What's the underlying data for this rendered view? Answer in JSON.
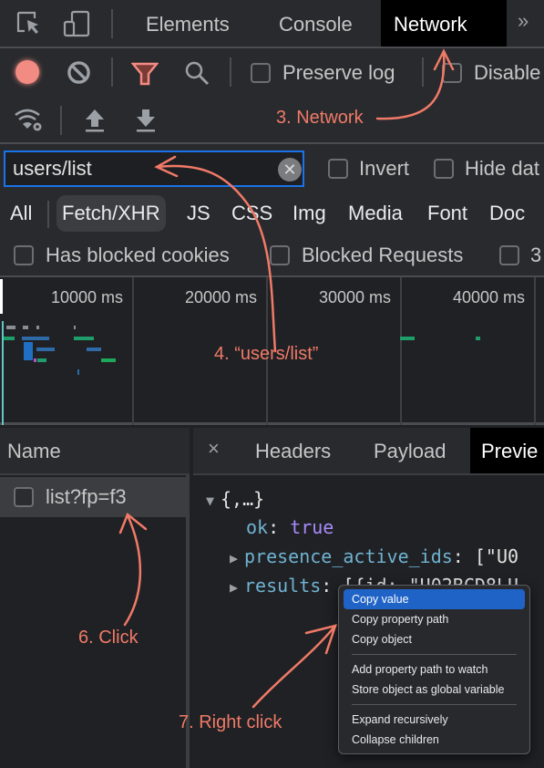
{
  "tabs": {
    "items": [
      {
        "label": "Elements",
        "active": false
      },
      {
        "label": "Console",
        "active": false
      },
      {
        "label": "Network",
        "active": true
      }
    ],
    "more_icon": "double-chevron-right"
  },
  "toolbar": {
    "icons": [
      "inspect-element-icon",
      "device-toolbar-icon",
      "record-icon",
      "clear-icon",
      "filter-icon",
      "search-icon",
      "network-conditions-icon",
      "import-har-icon",
      "export-har-icon"
    ],
    "preserve_log": {
      "label": "Preserve log",
      "checked": false
    },
    "disable_cache": {
      "label": "Disable",
      "checked": false
    },
    "record_color": "#f28b82",
    "filter_color": "#f28b82"
  },
  "filter": {
    "value": "users/list",
    "invert": {
      "label": "Invert",
      "checked": false
    },
    "hide_data_urls": {
      "label": "Hide dat",
      "checked": false
    }
  },
  "types": [
    {
      "label": "All",
      "active": false
    },
    {
      "label": "Fetch/XHR",
      "active": true
    },
    {
      "label": "JS",
      "active": false
    },
    {
      "label": "CSS",
      "active": false
    },
    {
      "label": "Img",
      "active": false
    },
    {
      "label": "Media",
      "active": false
    },
    {
      "label": "Font",
      "active": false
    },
    {
      "label": "Doc",
      "active": false
    }
  ],
  "blocked": {
    "has_blocked_cookies": {
      "label": "Has blocked cookies",
      "checked": false
    },
    "blocked_requests": {
      "label": "Blocked Requests",
      "checked": false
    },
    "third_party": {
      "label": "3",
      "checked": false
    }
  },
  "timeline": {
    "ticks": [
      "10000 ms",
      "20000 ms",
      "30000 ms",
      "40000 ms"
    ]
  },
  "requests": {
    "header": "Name",
    "rows": [
      {
        "name": "list?fp=f3",
        "selected": true
      }
    ]
  },
  "detail": {
    "tabs": [
      {
        "label": "Headers",
        "active": false
      },
      {
        "label": "Payload",
        "active": false
      },
      {
        "label": "Previe",
        "active": true
      }
    ],
    "close_label": "×",
    "preview": {
      "root": "{,…}",
      "ok_key": "ok",
      "ok_value": "true",
      "presence_key": "presence_active_ids",
      "presence_value": "[\"U0",
      "results_key": "results",
      "results_value": "[{id: \"U02BCD8LU"
    }
  },
  "context_menu": {
    "groups": [
      [
        "Copy value",
        "Copy property path",
        "Copy object"
      ],
      [
        "Add property path to watch",
        "Store object as global variable"
      ],
      [
        "Expand recursively",
        "Collapse children"
      ]
    ],
    "highlighted": "Copy value"
  },
  "annotations": {
    "step3": "3. Network",
    "step4": "4. “users/list”",
    "step6": "6. Click",
    "step7": "7. Right click",
    "color": "#f07a68"
  }
}
